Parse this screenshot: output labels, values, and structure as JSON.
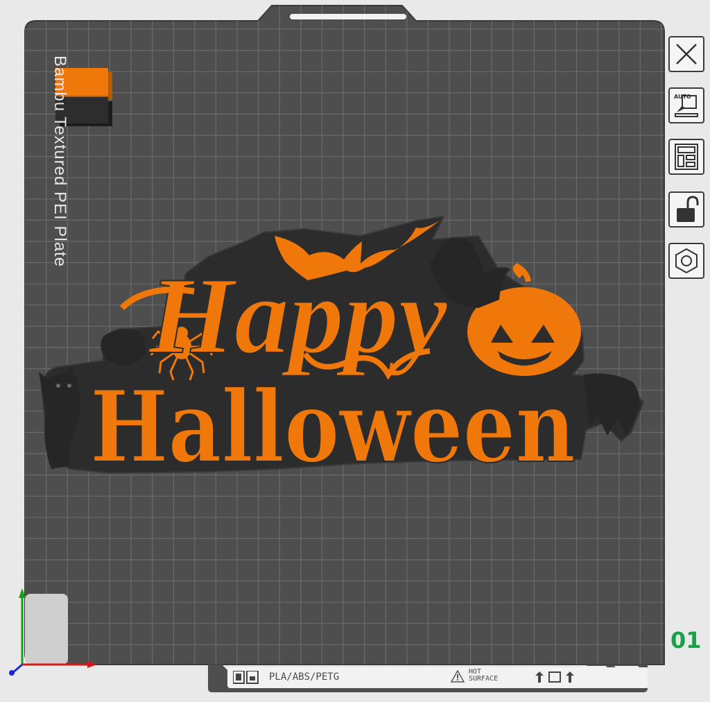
{
  "plate": {
    "label": "Bambu Textured PEI Plate",
    "number": "01",
    "grid_color": "#6b6b6b",
    "surface_color": "#4e4e4e"
  },
  "model": {
    "line1": "Happy",
    "line2": "Halloween",
    "primary_color": "#f0780a",
    "secondary_color": "#2c2c2c"
  },
  "filament_swatch": {
    "top_color": "#f0780a",
    "bottom_color": "#2d2d2d"
  },
  "toolbar": [
    {
      "name": "close-plate-button",
      "icon": "close-icon"
    },
    {
      "name": "auto-orient-button",
      "icon": "auto-orient-icon",
      "badge": "AUTO"
    },
    {
      "name": "arrange-button",
      "icon": "arrange-icon"
    },
    {
      "name": "lock-plate-button",
      "icon": "unlock-icon"
    },
    {
      "name": "plate-settings-button",
      "icon": "hex-settings-icon"
    }
  ],
  "bottom_bar": {
    "materials": "PLA/ABS/PETG",
    "hot_line1": "HOT",
    "hot_line2": "SURFACE"
  },
  "axes": {
    "x_color": "#d11a1a",
    "y_color": "#17a017",
    "z_color": "#1a2ad1"
  }
}
